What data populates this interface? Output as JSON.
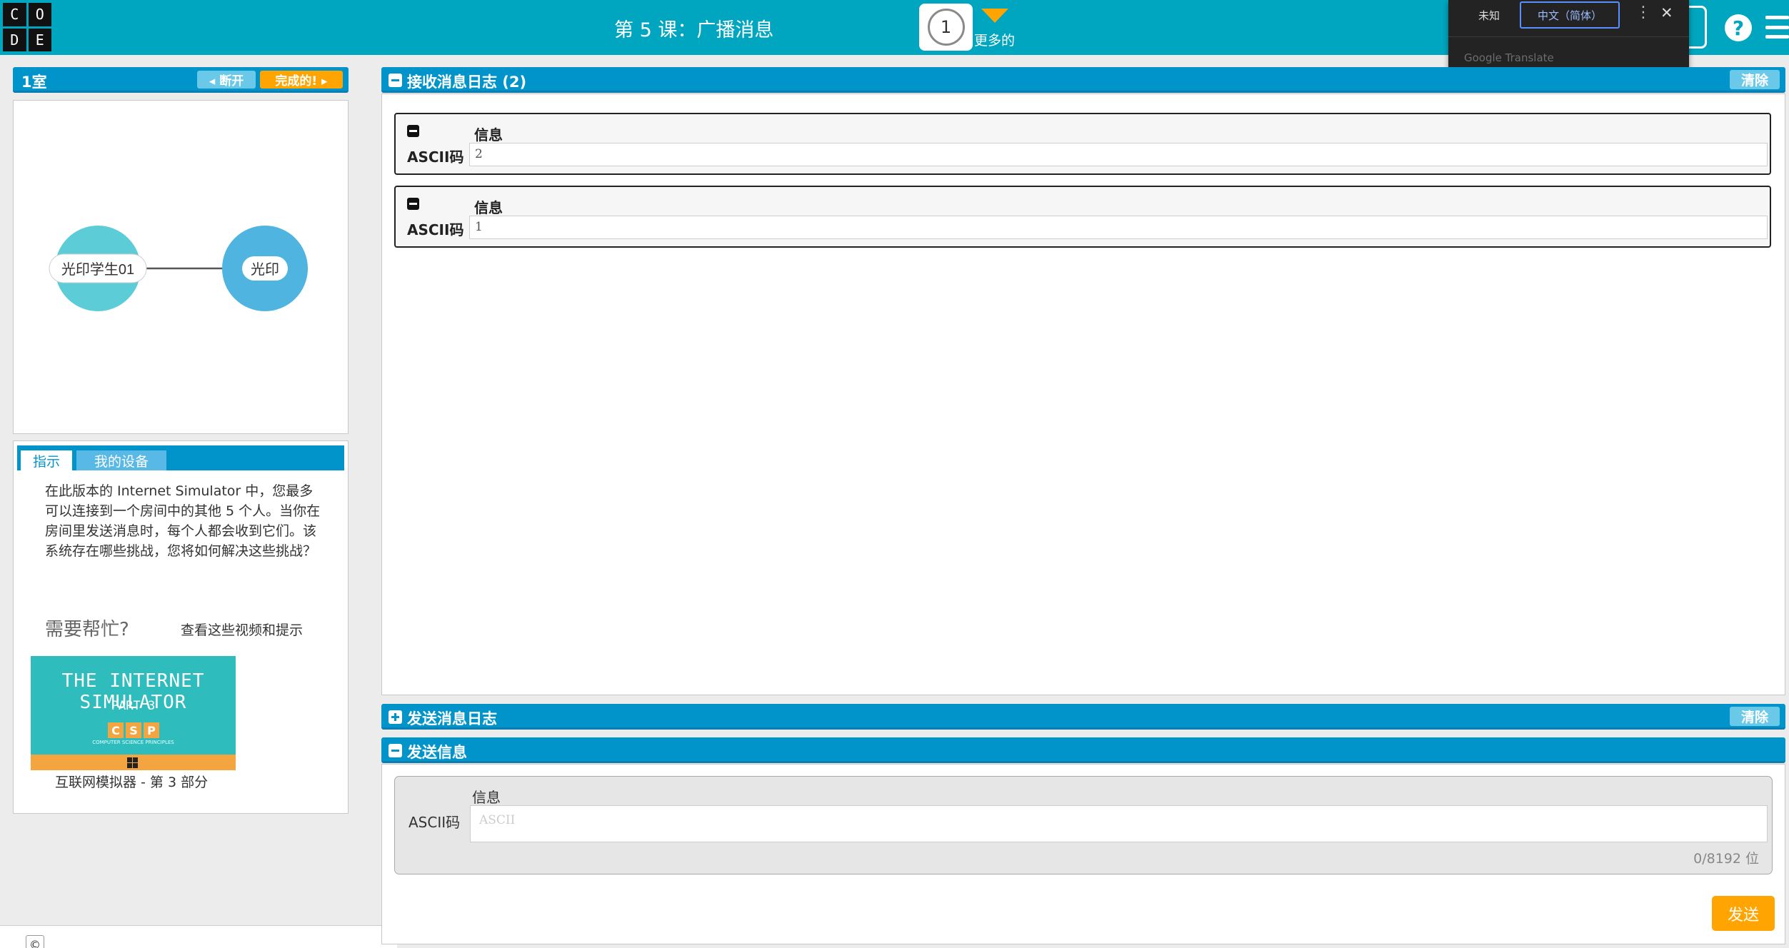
{
  "header": {
    "logo_letters": [
      "C",
      "O",
      "D",
      "E"
    ],
    "lesson_title": "第 5 课：广播消息",
    "progress_number": "1",
    "more_label": "更多的",
    "help_glyph": "?"
  },
  "translate_popup": {
    "tab_unknown": "未知",
    "tab_chinese": "中文（简体）",
    "more_glyph": "⋮",
    "close_glyph": "✕",
    "brand": "Google Translate"
  },
  "left_panel": {
    "room_name": "1室",
    "disconnect_label": "◂ 断开",
    "finish_label": "完成的! ▸",
    "network": {
      "node_left": "光印学生01",
      "node_right": "光印",
      "node_left_color": "#5ccdd6",
      "node_right_color": "#4fb4df"
    },
    "tabs": [
      "指示",
      "我的设备"
    ],
    "instructions": "在此版本的 Internet Simulator 中，您最多可以连接到一个房间中的其他 5 个人。当你在房间里发送消息时，每个人都会收到它们。该系统存在哪些挑战，您将如何解决这些挑战？",
    "help_title": "需要帮忙?",
    "help_link": "查看这些视频和提示",
    "video": {
      "title_line1": "THE INTERNET SIMULATOR",
      "title_line2": "PART 3",
      "badge_letters": [
        "C",
        "S",
        "P"
      ],
      "badge_subtitle": "COMPUTER SCIENCE PRINCIPLES",
      "caption": "互联网模拟器 - 第 3 部分"
    },
    "copyright_glyph": "©"
  },
  "received_log": {
    "title": "接收消息日志 (2)",
    "clear_label": "清除",
    "messages": [
      {
        "label": "信息",
        "encoding": "ASCII码",
        "value": "2"
      },
      {
        "label": "信息",
        "encoding": "ASCII码",
        "value": "1"
      }
    ]
  },
  "sent_log": {
    "title": "发送消息日志",
    "clear_label": "清除"
  },
  "send_message": {
    "title": "发送信息",
    "label": "信息",
    "encoding": "ASCII码",
    "placeholder": "ASCII",
    "bit_count": "0/8192 位",
    "send_label": "发送"
  },
  "colors": {
    "header": "#00a6bf",
    "panel_blue": "#0094ca",
    "accent_orange": "#ffa400"
  }
}
